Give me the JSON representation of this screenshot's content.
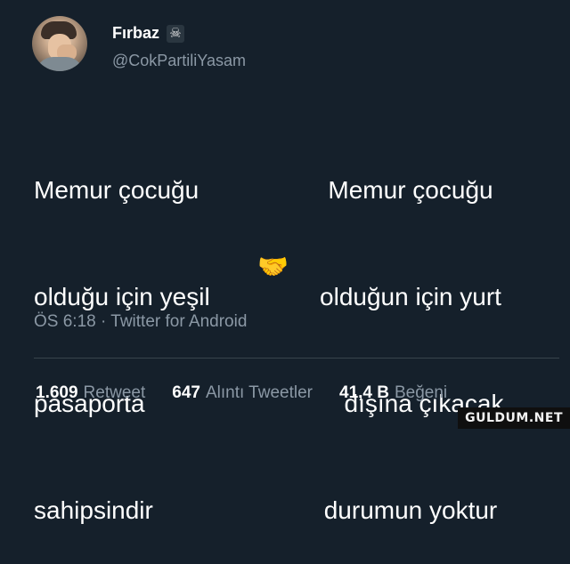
{
  "author": {
    "display_name": "Fırbaz",
    "badge_icon": "skull-crossbones-icon",
    "badge_glyph": "☠",
    "handle": "@CokPartiliYasam"
  },
  "tweet": {
    "left_lines": [
      "Memur çocuğu",
      "olduğu için yeşil",
      "pasaporta",
      "sahipsindir"
    ],
    "right_lines": [
      "Memur çocuğu",
      "olduğun için yurt",
      "dışına çıkacak",
      "durumun yoktur"
    ],
    "emoji": "🤝"
  },
  "meta": {
    "time": "ÖS 6:18",
    "separator": "·",
    "source": "Twitter for Android"
  },
  "stats": {
    "retweets_count": "1.609",
    "retweets_label": "Retweet",
    "quotes_count": "647",
    "quotes_label": "Alıntı Tweetler",
    "likes_count": "41,4 B",
    "likes_label": "Beğeni"
  },
  "watermark": "GULDUM.NET",
  "colors": {
    "background": "#15202b",
    "text": "#ffffff",
    "secondary": "#8b98a5",
    "divider": "#38444d"
  }
}
